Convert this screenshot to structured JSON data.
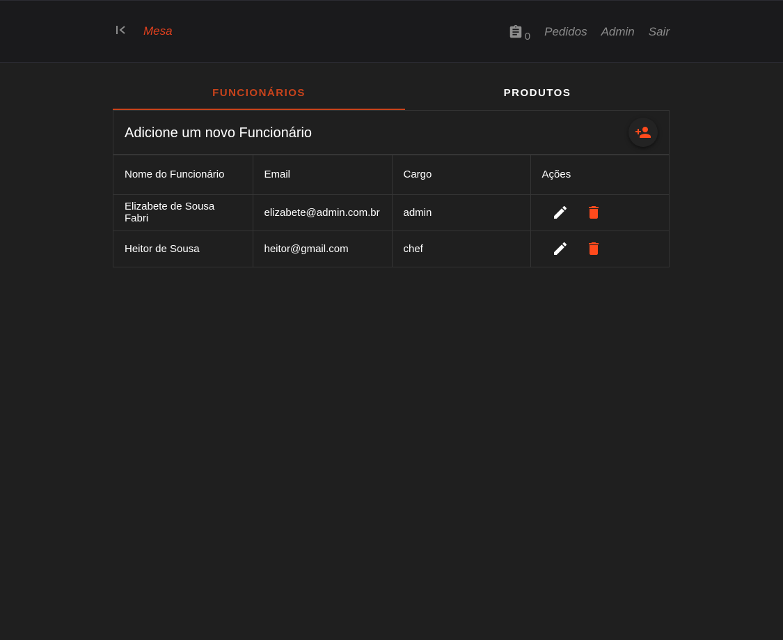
{
  "header": {
    "brand": "Mesa",
    "orders_count": "0",
    "nav": [
      "Pedidos",
      "Admin",
      "Sair"
    ],
    "icons": {
      "back": "first-page-icon",
      "orders": "clipboard-icon"
    }
  },
  "tabs": [
    {
      "label": "FUNCIONÁRIOS",
      "active": true
    },
    {
      "label": "PRODUTOS",
      "active": false
    }
  ],
  "card": {
    "title": "Adicione um novo Funcionário",
    "add_icon": "person-add-icon"
  },
  "table": {
    "columns": [
      "Nome do Funcionário",
      "Email",
      "Cargo",
      "Ações"
    ],
    "rows": [
      {
        "name": "Elizabete de Sousa Fabri",
        "email": "elizabete@admin.com.br",
        "role": "admin"
      },
      {
        "name": "Heitor de Sousa",
        "email": "heitor@gmail.com",
        "role": "chef"
      }
    ],
    "row_actions": [
      "edit-icon",
      "delete-icon"
    ]
  },
  "colors": {
    "accent": "#e0401e",
    "tab_accent": "#c9431b",
    "danger": "#ff4a1c",
    "background": "#1f1f1f",
    "header_bg": "#1a1a1c"
  }
}
